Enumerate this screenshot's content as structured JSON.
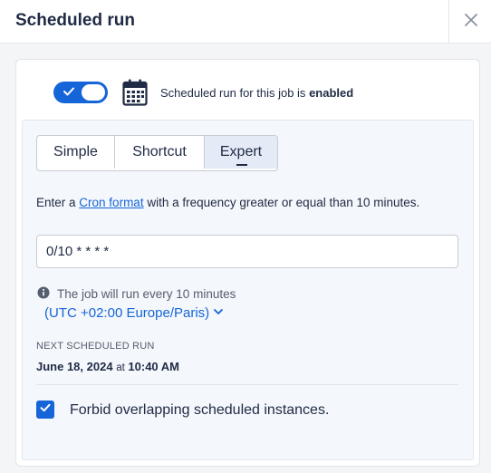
{
  "header": {
    "title": "Scheduled run"
  },
  "schedule": {
    "status_prefix": "Scheduled run for this job is",
    "status_value": "enabled",
    "toggle_on": true
  },
  "tabs": [
    {
      "label": "Simple",
      "selected": false
    },
    {
      "label": "Shortcut",
      "selected": false
    },
    {
      "label": "Expert",
      "selected": true
    }
  ],
  "expert": {
    "help_prefix": "Enter a",
    "help_link": "Cron format",
    "help_suffix": "with a frequency greater or equal than 10 minutes.",
    "cron_value": "0/10 * * * *",
    "info_text": "The job will run every 10 minutes",
    "timezone": "(UTC +02:00 Europe/Paris)"
  },
  "next_run": {
    "label": "NEXT SCHEDULED RUN",
    "date": "June 18, 2024",
    "at": "at",
    "time": "10:40 AM"
  },
  "overlap": {
    "label": "Forbid overlapping scheduled instances.",
    "checked": true
  },
  "colors": {
    "accent": "#1565d8",
    "text": "#1f2a44",
    "muted": "#555e6e"
  }
}
